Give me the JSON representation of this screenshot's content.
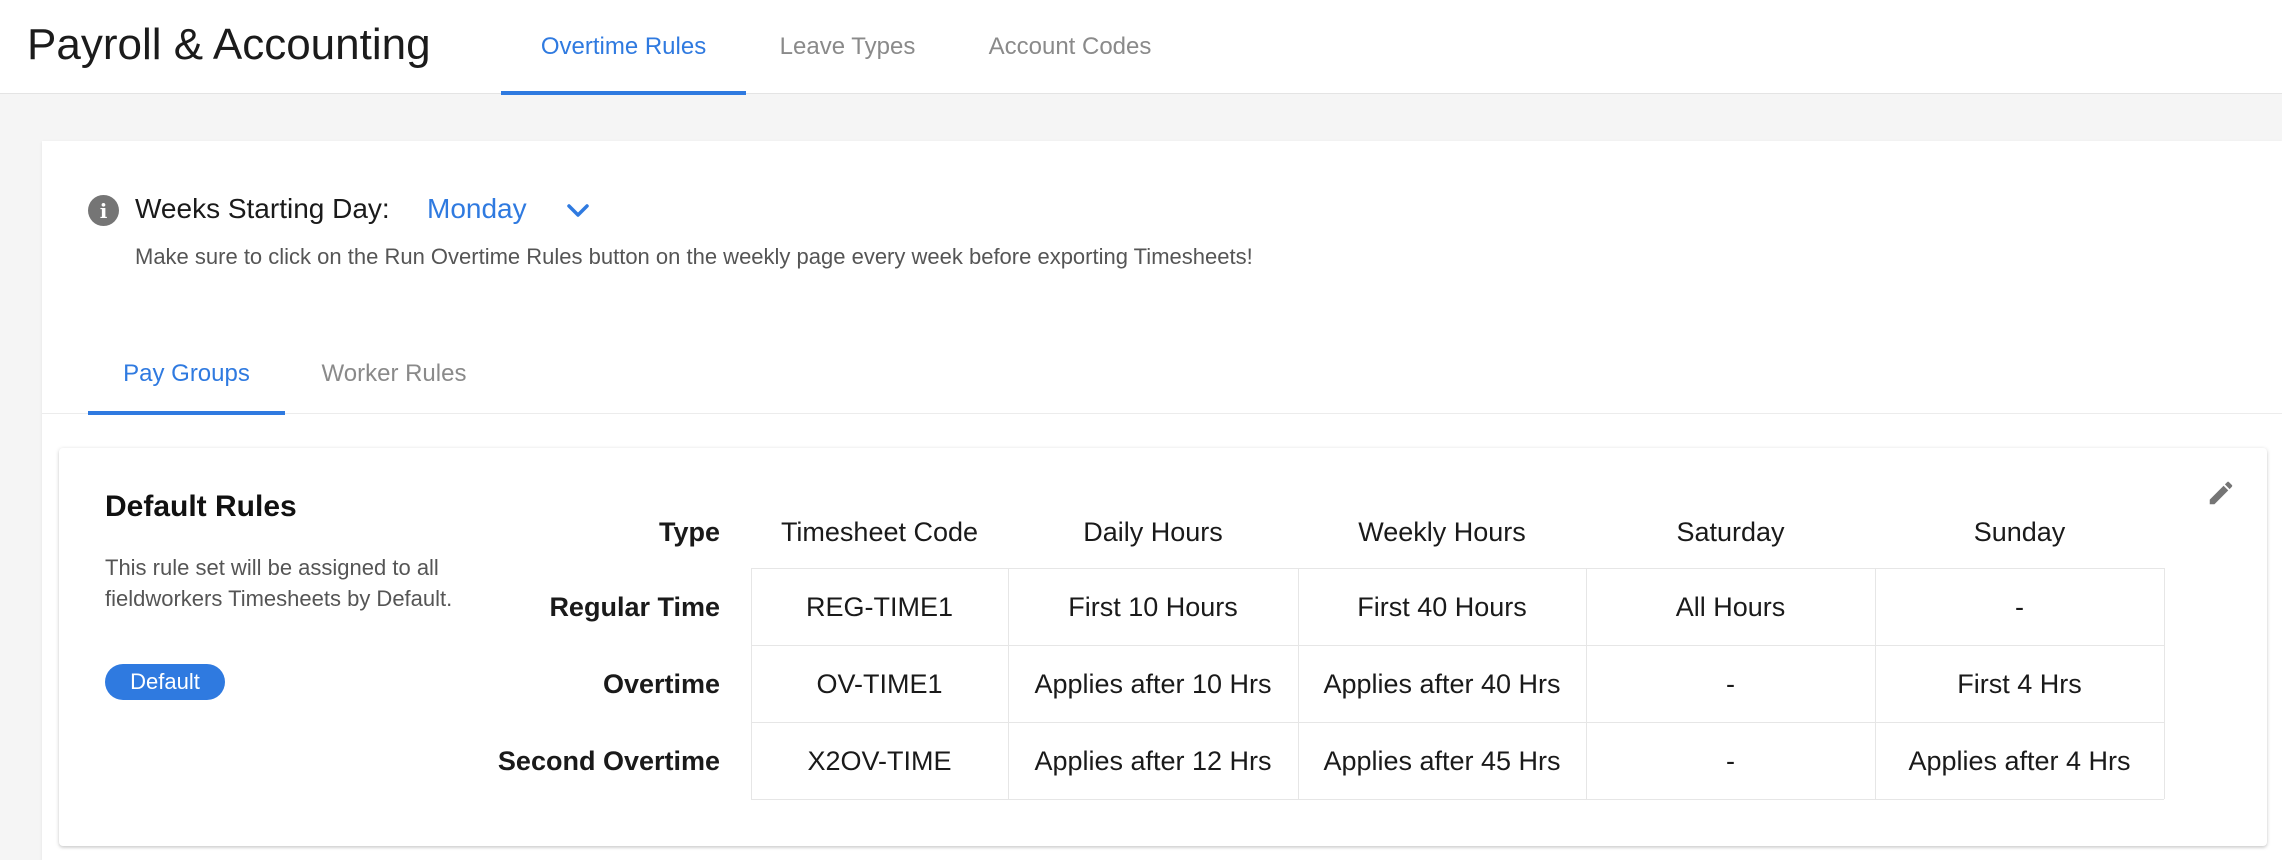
{
  "header": {
    "title": "Payroll & Accounting",
    "tabs": [
      {
        "label": "Overtime Rules",
        "active": true
      },
      {
        "label": "Leave Types",
        "active": false
      },
      {
        "label": "Account Codes",
        "active": false
      }
    ]
  },
  "weeks": {
    "label": "Weeks Starting Day:",
    "value": "Monday",
    "notice": "Make sure to click on the Run Overtime Rules button on the weekly page every week before exporting Timesheets!"
  },
  "sub_tabs": [
    {
      "label": "Pay Groups",
      "active": true
    },
    {
      "label": "Worker Rules",
      "active": false
    }
  ],
  "rules": {
    "title": "Default Rules",
    "description": "This rule set will be assigned to all fieldworkers Timesheets by Default.",
    "badge": "Default",
    "columns": [
      "Type",
      "Timesheet Code",
      "Daily Hours",
      "Weekly Hours",
      "Saturday",
      "Sunday"
    ],
    "rows": [
      {
        "type": "Regular Time",
        "code": "REG-TIME1",
        "daily": "First 10 Hours",
        "weekly": "First 40 Hours",
        "saturday": "All Hours",
        "sunday": "-"
      },
      {
        "type": "Overtime",
        "code": "OV-TIME1",
        "daily": "Applies after 10 Hrs",
        "weekly": "Applies after 40 Hrs",
        "saturday": "-",
        "sunday": "First 4 Hrs"
      },
      {
        "type": "Second Overtime",
        "code": "X2OV-TIME",
        "daily": "Applies after 12 Hrs",
        "weekly": "Applies after 45 Hrs",
        "saturday": "-",
        "sunday": "Applies after 4 Hrs"
      }
    ]
  },
  "colors": {
    "accent": "#2f7ae0",
    "muted_text": "#8a8a8a",
    "grid_line": "#e6e6e6"
  },
  "icons": {
    "info": "info-icon",
    "dropdown": "chevron-down-icon",
    "edit": "pencil-icon"
  }
}
